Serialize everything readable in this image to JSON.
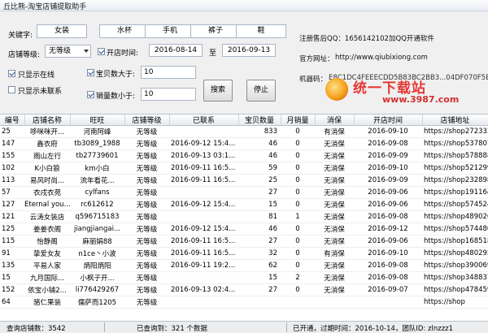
{
  "window": {
    "title": "丘比熊-淘宝店铺提取助手"
  },
  "filters": {
    "keyword_label": "关键字:",
    "keywords": [
      "女装",
      "水杯",
      "手机",
      "裤子",
      "鞋"
    ],
    "level_label": "店铺等级:",
    "level_value": "无等级",
    "open_time_checkbox": {
      "label": "开店时间:",
      "checked": true
    },
    "date_from": "2016-08-14",
    "date_to_label": "至",
    "date_to": "2016-09-13",
    "online_only": {
      "label": "只显示在线",
      "checked": true
    },
    "uncontacted_only": {
      "label": "只显示未联系",
      "checked": false
    },
    "items_more": {
      "label": "宝贝数大于:",
      "checked": true,
      "value": "10"
    },
    "sales_less": {
      "label": "销量数小于:",
      "checked": true,
      "value": "10"
    },
    "search_label": "搜索",
    "stop_label": "停止"
  },
  "info": {
    "support_qq": "注册售后QQ：1656142102",
    "join_group": "加QQ开通软件",
    "official_site_label": "官方网址：",
    "official_site_url": "http://www.qiubixiong.com",
    "machine_code_label": "机器码：",
    "machine_code": "E8C1DC4FEEECDD5B83BC2BB3...04DF070F5B"
  },
  "watermark": {
    "brand": "统一下载站",
    "url": "www.3987.com"
  },
  "table": {
    "columns": [
      "编号",
      "店铺名称",
      "旺旺",
      "店铺等级",
      "已联系",
      "宝贝数量",
      "月销量",
      "消保",
      "开店时间",
      "店铺地址"
    ],
    "rows": [
      [
        "25",
        "哆咪咪开...",
        "河南阿峰",
        "无等级",
        "",
        "833",
        "0",
        "有消保",
        "2016-09-10",
        "https://shop272333"
      ],
      [
        "147",
        "鑫衣府",
        "tb3089_1988",
        "无等级",
        "2016-09-12 15:4...",
        "46",
        "0",
        "无消保",
        "2016-09-08",
        "https://shop537807"
      ],
      [
        "155",
        "雨山左行",
        "tb27739601",
        "无等级",
        "2016-09-13 03:1...",
        "46",
        "0",
        "无消保",
        "2016-09-09",
        "https://shop578888"
      ],
      [
        "102",
        "K小白狼",
        "km小白",
        "无等级",
        "2016-09-11 16:5...",
        "59",
        "0",
        "无消保",
        "2016-09-10",
        "https://shop521299"
      ],
      [
        "113",
        "易风时尚...",
        "流年看花...",
        "无等级",
        "2016-09-11 16:5...",
        "25",
        "0",
        "无消保",
        "2016-09-09",
        "https://shop232898"
      ],
      [
        "57",
        "衣戌衣苑",
        "cylfans",
        "无等级",
        "",
        "27",
        "0",
        "无消保",
        "2016-09-06",
        "https://shop191164"
      ],
      [
        "127",
        "Eternal you...",
        "rc612612",
        "无等级",
        "2016-09-12 15:4...",
        "15",
        "0",
        "无消保",
        "2016-09-06",
        "https://shop574524"
      ],
      [
        "121",
        "云涛女装店",
        "q596715183",
        "无等级",
        "",
        "81",
        "1",
        "无消保",
        "2016-09-08",
        "https://shop489026"
      ],
      [
        "125",
        "姜姜衣阁",
        "jiangjiangai...",
        "无等级",
        "2016-09-12 15:4...",
        "46",
        "0",
        "无消保",
        "2016-09-12",
        "https://shop574480"
      ],
      [
        "115",
        "怡静阁",
        "麻丽娟88",
        "无等级",
        "2016-09-11 16:5...",
        "27",
        "0",
        "无消保",
        "2016-09-06",
        "https://shop168518"
      ],
      [
        "91",
        "挚爱女友",
        "n1ce丶小波",
        "无等级",
        "2016-09-11 16:5...",
        "32",
        "0",
        "有消保",
        "2016-09-10",
        "https://shop480295"
      ],
      [
        "135",
        "平易人家",
        "炳阳炳阳",
        "无等级",
        "2016-09-11 19:2...",
        "62",
        "0",
        "无消保",
        "2016-09-08",
        "https://shop390069"
      ],
      [
        "15",
        "九月国际...",
        "小枫子开...",
        "无等级",
        "",
        "15",
        "2",
        "无消保",
        "2016-09-08",
        "https://shop348837"
      ],
      [
        "152",
        "依宝小铺2...",
        "li776429267",
        "无等级",
        "2016-09-13 02:4...",
        "27",
        "0",
        "无消保",
        "2016-09-07",
        "https://shop478459"
      ],
      [
        "64",
        "骆仁果装",
        "儒萨而1205",
        "无等级",
        "",
        "",
        "",
        "",
        "",
        "https://shop"
      ]
    ]
  },
  "status": {
    "total_shops": "查询店铺数：3542",
    "exported": "已查询到：321 个数据",
    "activated": "已开通，过期时间：2016-10-14，团队ID: zlnzzz1"
  }
}
